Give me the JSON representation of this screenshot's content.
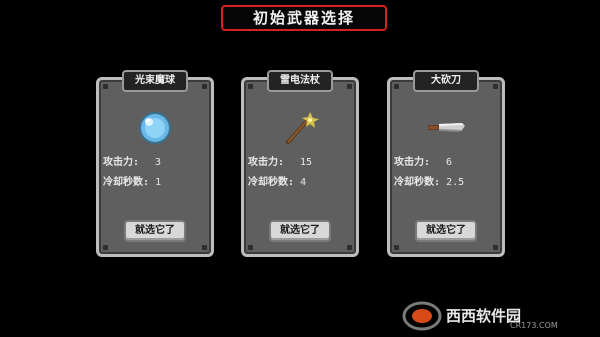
{
  "title": "初始武器选择",
  "stat_labels": {
    "attack": "攻击力:",
    "cooldown": "冷却秒数:"
  },
  "cards": [
    {
      "name": "光束魔球",
      "icon": "orb-icon",
      "attack": "3",
      "cooldown": "1",
      "button": "就选它了"
    },
    {
      "name": "雷电法杖",
      "icon": "staff-icon",
      "attack": "15",
      "cooldown": "4",
      "button": "就选它了"
    },
    {
      "name": "大砍刀",
      "icon": "machete-icon",
      "attack": "6",
      "cooldown": "2.5",
      "button": "就选它了"
    }
  ],
  "watermark": {
    "brand": "西西软件园",
    "url": "CR173.COM"
  }
}
